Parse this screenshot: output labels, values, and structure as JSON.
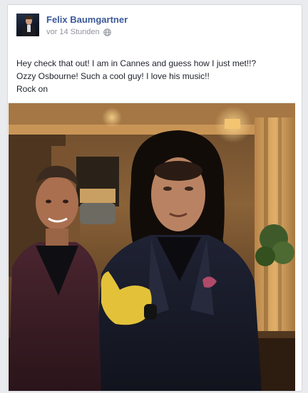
{
  "post": {
    "author": "Felix Baumgartner",
    "timestamp": "vor 14 Stunden",
    "privacy_icon": "globe-icon",
    "text_lines": [
      "Hey check that out! I am in Cannes and guess how I just met!!?",
      "Ozzy Osbourne! Such a cool guy! I love his music!!",
      "Rock on"
    ]
  },
  "colors": {
    "author_link": "#3b5998",
    "meta_gray": "#90949c",
    "card_border": "#d3d6db"
  }
}
